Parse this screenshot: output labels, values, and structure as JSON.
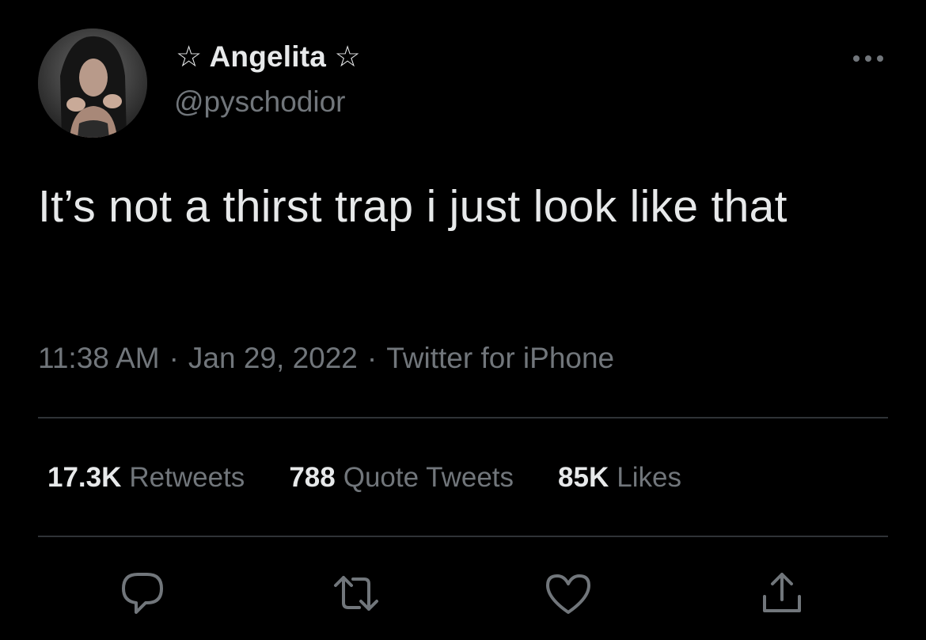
{
  "user": {
    "display_name": "☆ Angelita ☆",
    "handle": "@pyschodior"
  },
  "tweet": {
    "text": "It’s not a thirst trap i just look like that",
    "time": "11:38 AM",
    "date": "Jan 29, 2022",
    "source": "Twitter for iPhone",
    "separator": "·"
  },
  "stats": {
    "retweets": {
      "count": "17.3K",
      "label": "Retweets"
    },
    "quotes": {
      "count": "788",
      "label": "Quote Tweets"
    },
    "likes": {
      "count": "85K",
      "label": "Likes"
    }
  },
  "icons": {
    "more": "more-horizontal-icon",
    "reply": "reply-icon",
    "retweet": "retweet-icon",
    "like": "heart-icon",
    "share": "share-icon"
  },
  "colors": {
    "background": "#000000",
    "text_primary": "#e7e9ea",
    "text_secondary": "#71767b",
    "divider": "#2f3336"
  }
}
